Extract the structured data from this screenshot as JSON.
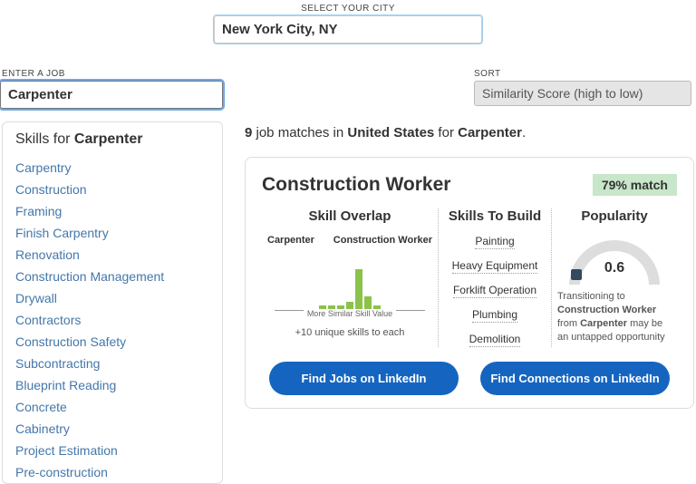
{
  "labels": {
    "city": "SELECT YOUR CITY",
    "job": "ENTER A JOB",
    "sort": "SORT"
  },
  "inputs": {
    "city": "New York City, NY",
    "job": "Carpenter",
    "sort": "Similarity Score (high to low)"
  },
  "sidebar": {
    "prefix": "Skills for ",
    "job": "Carpenter",
    "skills": [
      "Carpentry",
      "Construction",
      "Framing",
      "Finish Carpentry",
      "Renovation",
      "Construction Management",
      "Drywall",
      "Contractors",
      "Construction Safety",
      "Subcontracting",
      "Blueprint Reading",
      "Concrete",
      "Cabinetry",
      "Project Estimation",
      "Pre-construction"
    ]
  },
  "results": {
    "count": "9",
    "mid1": " job matches in ",
    "loc": "United States",
    "mid2": " for ",
    "job": "Carpenter",
    "end": "."
  },
  "card": {
    "title": "Construction Worker",
    "match": "79% match",
    "overlap": {
      "title": "Skill Overlap",
      "left": "Carpenter",
      "right": "Construction Worker",
      "axis_label": "More Similar Skill Value",
      "note": "+10 unique skills to each"
    },
    "build": {
      "title": "Skills To Build",
      "items": [
        "Painting",
        "Heavy Equipment",
        "Forklift Operation",
        "Plumbing",
        "Demolition"
      ]
    },
    "popularity": {
      "title": "Popularity",
      "value": "0.6",
      "t1": "Transitioning to ",
      "t2": "Construction Worker",
      "t3": " from ",
      "t4": "Carpenter",
      "t5": " may be an untapped opportunity"
    },
    "buttons": {
      "jobs": "Find Jobs on LinkedIn",
      "conns": "Find Connections on LinkedIn"
    }
  },
  "chart_data": {
    "type": "bar",
    "title": "Skill Overlap",
    "xlabel": "More Similar Skill Value",
    "ylabel": "",
    "categories": [
      "b1",
      "b2",
      "b3",
      "b4",
      "b5",
      "b6",
      "b7"
    ],
    "values": [
      4,
      4,
      4,
      8,
      44,
      14,
      4
    ],
    "note": "+10 unique skills to each"
  }
}
